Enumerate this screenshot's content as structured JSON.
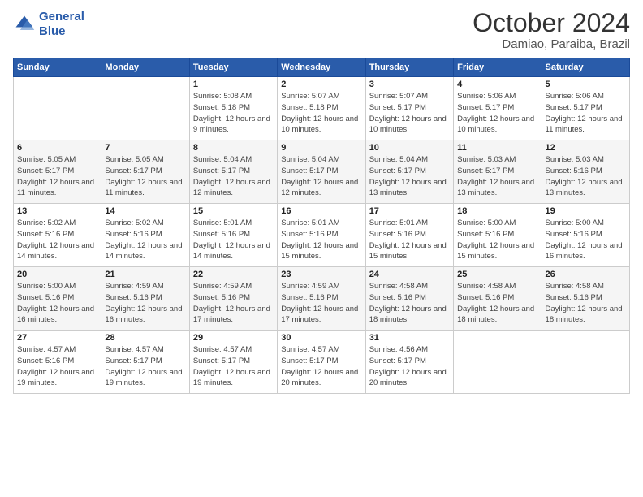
{
  "logo": {
    "line1": "General",
    "line2": "Blue"
  },
  "title": "October 2024",
  "subtitle": "Damiao, Paraiba, Brazil",
  "days_of_week": [
    "Sunday",
    "Monday",
    "Tuesday",
    "Wednesday",
    "Thursday",
    "Friday",
    "Saturday"
  ],
  "weeks": [
    [
      {
        "day": "",
        "detail": ""
      },
      {
        "day": "",
        "detail": ""
      },
      {
        "day": "1",
        "detail": "Sunrise: 5:08 AM\nSunset: 5:18 PM\nDaylight: 12 hours and 9 minutes."
      },
      {
        "day": "2",
        "detail": "Sunrise: 5:07 AM\nSunset: 5:18 PM\nDaylight: 12 hours and 10 minutes."
      },
      {
        "day": "3",
        "detail": "Sunrise: 5:07 AM\nSunset: 5:17 PM\nDaylight: 12 hours and 10 minutes."
      },
      {
        "day": "4",
        "detail": "Sunrise: 5:06 AM\nSunset: 5:17 PM\nDaylight: 12 hours and 10 minutes."
      },
      {
        "day": "5",
        "detail": "Sunrise: 5:06 AM\nSunset: 5:17 PM\nDaylight: 12 hours and 11 minutes."
      }
    ],
    [
      {
        "day": "6",
        "detail": "Sunrise: 5:05 AM\nSunset: 5:17 PM\nDaylight: 12 hours and 11 minutes."
      },
      {
        "day": "7",
        "detail": "Sunrise: 5:05 AM\nSunset: 5:17 PM\nDaylight: 12 hours and 11 minutes."
      },
      {
        "day": "8",
        "detail": "Sunrise: 5:04 AM\nSunset: 5:17 PM\nDaylight: 12 hours and 12 minutes."
      },
      {
        "day": "9",
        "detail": "Sunrise: 5:04 AM\nSunset: 5:17 PM\nDaylight: 12 hours and 12 minutes."
      },
      {
        "day": "10",
        "detail": "Sunrise: 5:04 AM\nSunset: 5:17 PM\nDaylight: 12 hours and 13 minutes."
      },
      {
        "day": "11",
        "detail": "Sunrise: 5:03 AM\nSunset: 5:17 PM\nDaylight: 12 hours and 13 minutes."
      },
      {
        "day": "12",
        "detail": "Sunrise: 5:03 AM\nSunset: 5:16 PM\nDaylight: 12 hours and 13 minutes."
      }
    ],
    [
      {
        "day": "13",
        "detail": "Sunrise: 5:02 AM\nSunset: 5:16 PM\nDaylight: 12 hours and 14 minutes."
      },
      {
        "day": "14",
        "detail": "Sunrise: 5:02 AM\nSunset: 5:16 PM\nDaylight: 12 hours and 14 minutes."
      },
      {
        "day": "15",
        "detail": "Sunrise: 5:01 AM\nSunset: 5:16 PM\nDaylight: 12 hours and 14 minutes."
      },
      {
        "day": "16",
        "detail": "Sunrise: 5:01 AM\nSunset: 5:16 PM\nDaylight: 12 hours and 15 minutes."
      },
      {
        "day": "17",
        "detail": "Sunrise: 5:01 AM\nSunset: 5:16 PM\nDaylight: 12 hours and 15 minutes."
      },
      {
        "day": "18",
        "detail": "Sunrise: 5:00 AM\nSunset: 5:16 PM\nDaylight: 12 hours and 15 minutes."
      },
      {
        "day": "19",
        "detail": "Sunrise: 5:00 AM\nSunset: 5:16 PM\nDaylight: 12 hours and 16 minutes."
      }
    ],
    [
      {
        "day": "20",
        "detail": "Sunrise: 5:00 AM\nSunset: 5:16 PM\nDaylight: 12 hours and 16 minutes."
      },
      {
        "day": "21",
        "detail": "Sunrise: 4:59 AM\nSunset: 5:16 PM\nDaylight: 12 hours and 16 minutes."
      },
      {
        "day": "22",
        "detail": "Sunrise: 4:59 AM\nSunset: 5:16 PM\nDaylight: 12 hours and 17 minutes."
      },
      {
        "day": "23",
        "detail": "Sunrise: 4:59 AM\nSunset: 5:16 PM\nDaylight: 12 hours and 17 minutes."
      },
      {
        "day": "24",
        "detail": "Sunrise: 4:58 AM\nSunset: 5:16 PM\nDaylight: 12 hours and 18 minutes."
      },
      {
        "day": "25",
        "detail": "Sunrise: 4:58 AM\nSunset: 5:16 PM\nDaylight: 12 hours and 18 minutes."
      },
      {
        "day": "26",
        "detail": "Sunrise: 4:58 AM\nSunset: 5:16 PM\nDaylight: 12 hours and 18 minutes."
      }
    ],
    [
      {
        "day": "27",
        "detail": "Sunrise: 4:57 AM\nSunset: 5:16 PM\nDaylight: 12 hours and 19 minutes."
      },
      {
        "day": "28",
        "detail": "Sunrise: 4:57 AM\nSunset: 5:17 PM\nDaylight: 12 hours and 19 minutes."
      },
      {
        "day": "29",
        "detail": "Sunrise: 4:57 AM\nSunset: 5:17 PM\nDaylight: 12 hours and 19 minutes."
      },
      {
        "day": "30",
        "detail": "Sunrise: 4:57 AM\nSunset: 5:17 PM\nDaylight: 12 hours and 20 minutes."
      },
      {
        "day": "31",
        "detail": "Sunrise: 4:56 AM\nSunset: 5:17 PM\nDaylight: 12 hours and 20 minutes."
      },
      {
        "day": "",
        "detail": ""
      },
      {
        "day": "",
        "detail": ""
      }
    ]
  ]
}
